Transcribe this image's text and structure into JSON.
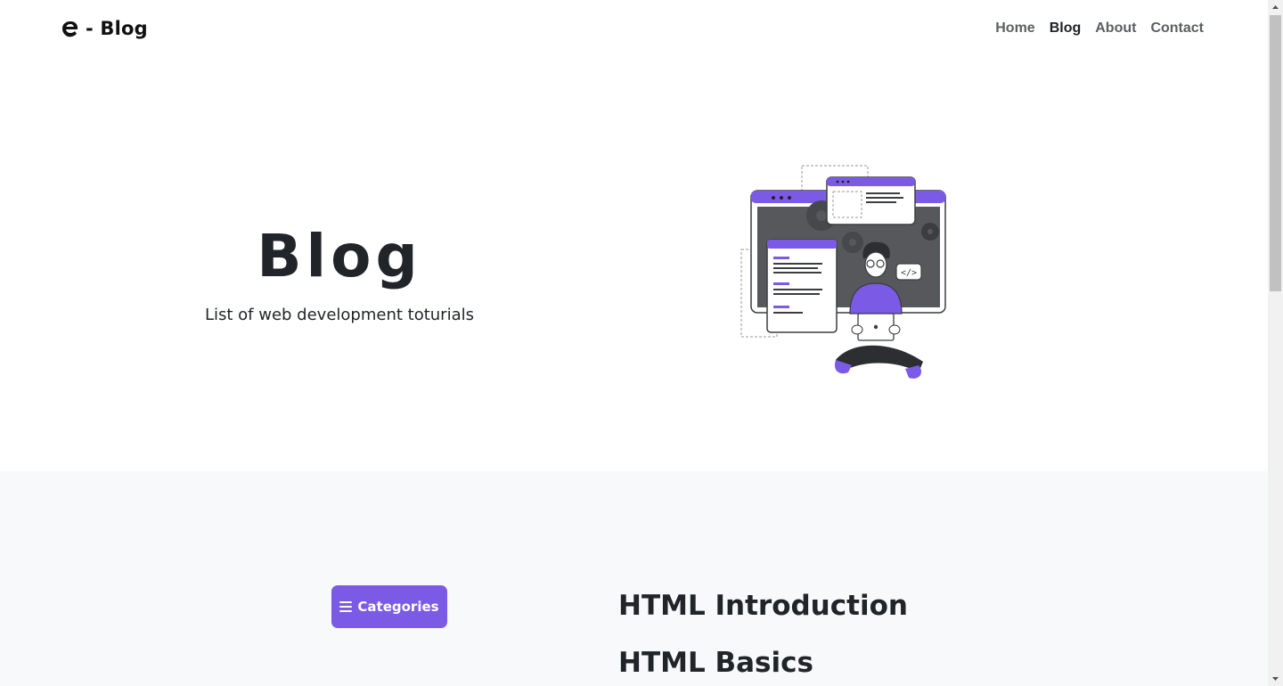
{
  "brand": {
    "text": "- Blog",
    "logo_icon": "e-logo-icon"
  },
  "nav": {
    "items": [
      "Home",
      "Blog",
      "About",
      "Contact"
    ],
    "active": "Blog"
  },
  "hero": {
    "title": "Blog",
    "subtitle": "List of web development toturials",
    "illustration": "developer-with-laptop-illustration"
  },
  "sidebar": {
    "categories_label": "Categories",
    "categories_icon": "menu-icon"
  },
  "posts": [
    "HTML Introduction",
    "HTML Basics"
  ],
  "colors": {
    "accent": "#7b5ae6",
    "content_bg": "#f8f9fa",
    "text": "#212529"
  }
}
